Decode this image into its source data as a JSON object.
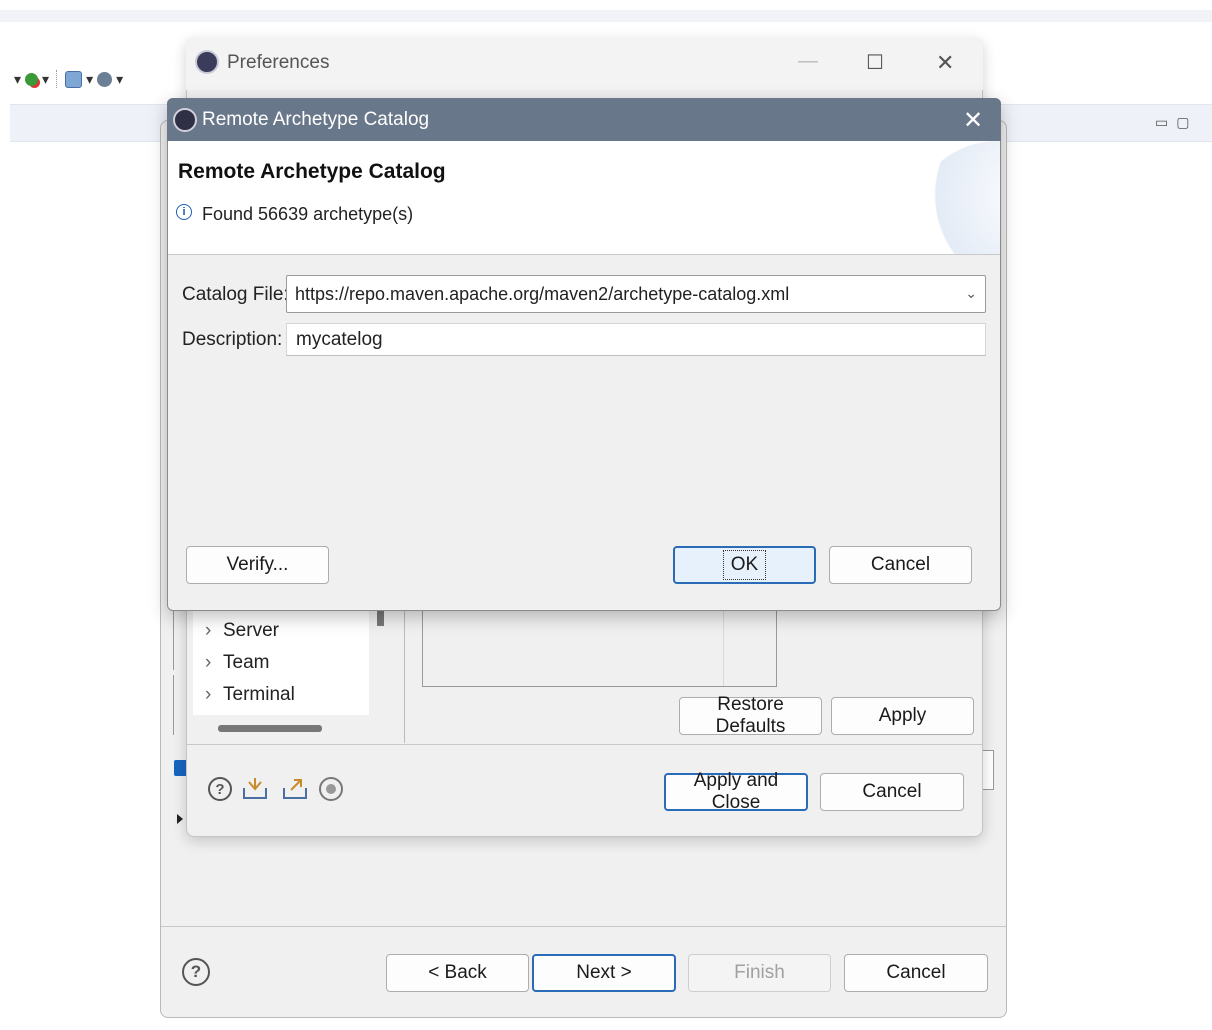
{
  "background": {
    "toolbar_icons": [
      "run-dropdown-icon",
      "new-server-icon",
      "external-tools-icon"
    ],
    "editor_controls": {
      "minimize": "▭",
      "maximize": "▢"
    }
  },
  "wizard": {
    "help_label": "?",
    "buttons": {
      "back": "< Back",
      "next": "Next >",
      "finish": "Finish",
      "cancel": "Cancel"
    }
  },
  "preferences": {
    "title": "Preferences",
    "tree_items": [
      {
        "label": "Server"
      },
      {
        "label": "Team"
      },
      {
        "label": "Terminal"
      }
    ],
    "buttons": {
      "restore_defaults": "Restore Defaults",
      "apply": "Apply",
      "apply_and_close": "Apply and Close",
      "cancel": "Cancel"
    },
    "bottom_icons": [
      "help-icon",
      "import-icon",
      "export-icon",
      "record-icon"
    ]
  },
  "remote_catalog": {
    "title": "Remote Archetype Catalog",
    "heading": "Remote Archetype Catalog",
    "info_message": "Found 56639 archetype(s)",
    "catalog_file_label": "Catalog File:",
    "catalog_file_value": "https://repo.maven.apache.org/maven2/archetype-catalog.xml",
    "description_label": "Description:",
    "description_value": "mycatelog",
    "buttons": {
      "verify": "Verify...",
      "ok": "OK",
      "cancel": "Cancel"
    }
  }
}
